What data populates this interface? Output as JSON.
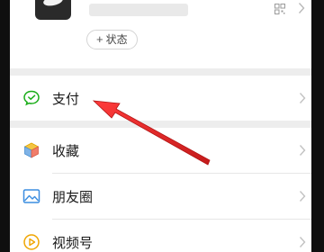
{
  "profile": {
    "status_button_label": "状态",
    "status_plus": "+"
  },
  "menu": {
    "pay": {
      "label": "支付",
      "icon": "wechat-pay-icon",
      "color": "#1aad19"
    },
    "favorites": {
      "label": "收藏",
      "icon": "cube-icon"
    },
    "moments": {
      "label": "朋友圈",
      "icon": "image-icon"
    },
    "channels": {
      "label": "视频号",
      "icon": "play-circle-icon"
    }
  },
  "annotation": {
    "color": "#e53030"
  }
}
